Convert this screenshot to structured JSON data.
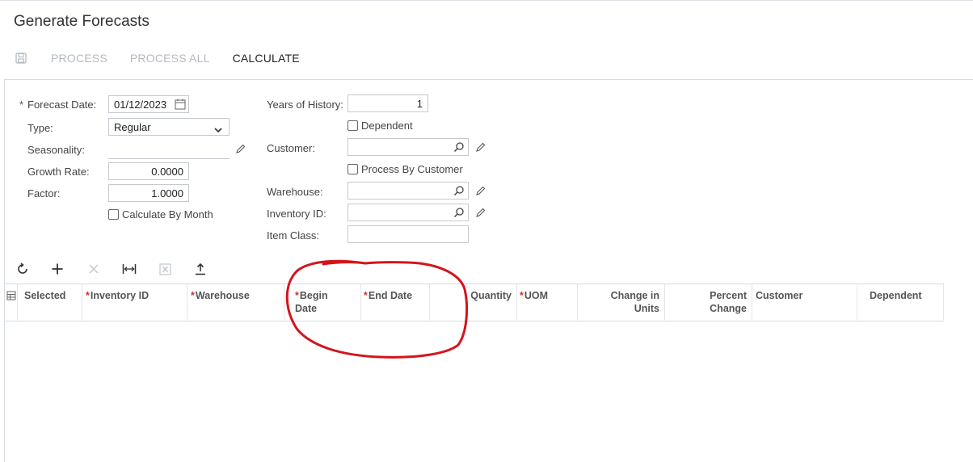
{
  "page": {
    "title": "Generate Forecasts"
  },
  "toolbar": {
    "save_icon": "save-icon",
    "process_label": "PROCESS",
    "process_all_label": "PROCESS ALL",
    "calculate_label": "CALCULATE"
  },
  "form": {
    "forecast_date": {
      "label": "Forecast Date:",
      "value": "01/12/2023"
    },
    "type": {
      "label": "Type:",
      "value": "Regular"
    },
    "seasonality": {
      "label": "Seasonality:",
      "value": ""
    },
    "growth_rate": {
      "label": "Growth Rate:",
      "value": "0.0000"
    },
    "factor": {
      "label": "Factor:",
      "value": "1.0000"
    },
    "calculate_by_month": {
      "label": "Calculate By Month"
    },
    "years_of_history": {
      "label": "Years of History:",
      "value": "1"
    },
    "dependent": {
      "label": "Dependent"
    },
    "customer": {
      "label": "Customer:",
      "value": ""
    },
    "process_by_customer": {
      "label": "Process By Customer"
    },
    "warehouse": {
      "label": "Warehouse:",
      "value": ""
    },
    "inventory_id": {
      "label": "Inventory ID:",
      "value": ""
    },
    "item_class": {
      "label": "Item Class:",
      "value": ""
    }
  },
  "grid": {
    "columns": [
      {
        "key": "selected",
        "label": "Selected",
        "required": false
      },
      {
        "key": "inventory_id",
        "label": "Inventory ID",
        "required": true
      },
      {
        "key": "warehouse",
        "label": "Warehouse",
        "required": true
      },
      {
        "key": "begin_date",
        "label": "Begin Date",
        "required": true
      },
      {
        "key": "end_date",
        "label": "End Date",
        "required": true
      },
      {
        "key": "quantity",
        "label": "Quantity",
        "required": false
      },
      {
        "key": "uom",
        "label": "UOM",
        "required": true
      },
      {
        "key": "change_in_units",
        "label": "Change in Units",
        "required": false
      },
      {
        "key": "percent_change",
        "label": "Percent Change",
        "required": false
      },
      {
        "key": "customer",
        "label": "Customer",
        "required": false
      },
      {
        "key": "dependent",
        "label": "Dependent",
        "required": false
      }
    ],
    "rows": []
  },
  "colors": {
    "required_star": "#d03030",
    "annotation": "#d4141c",
    "disabled_text": "#b5bac0",
    "border": "#c4c9cf"
  }
}
